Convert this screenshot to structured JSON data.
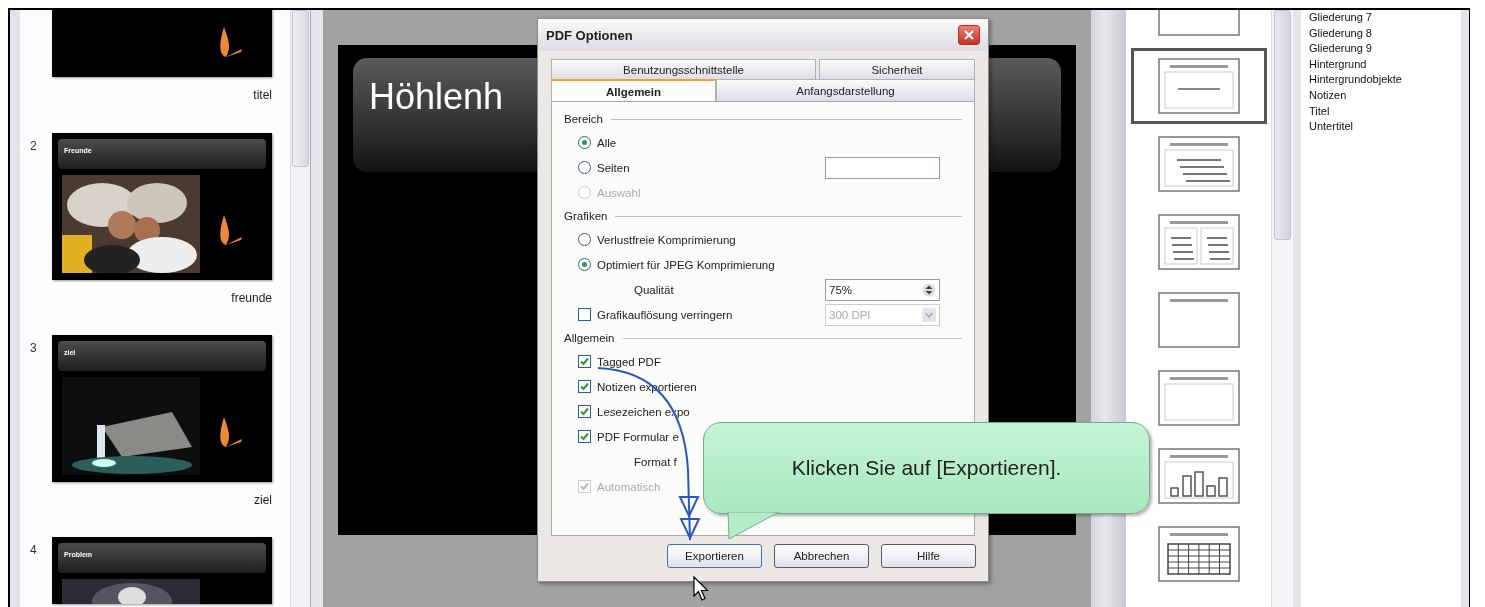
{
  "slide_panel": {
    "slides": [
      {
        "kind": "title",
        "caption": "titel"
      },
      {
        "kind": "picture",
        "number": "2",
        "heading": "Freunde",
        "caption": "freunde"
      },
      {
        "kind": "picture",
        "number": "3",
        "heading": "ziel",
        "caption": "ziel"
      },
      {
        "kind": "picture",
        "number": "4",
        "heading": "Problem"
      }
    ]
  },
  "editor": {
    "slide_title": "Höhlenh"
  },
  "dialog": {
    "title": "PDF Optionen",
    "tab_rows": [
      {
        "tabs": [
          {
            "label": "Benutzungsschnittstelle",
            "selected": false
          },
          {
            "label": "Sicherheit",
            "selected": false
          }
        ]
      },
      {
        "tabs": [
          {
            "label": "Allgemein",
            "selected": true
          },
          {
            "label": "Anfangsdarstellung",
            "selected": false
          }
        ]
      }
    ],
    "sections": [
      {
        "heading": "Bereich",
        "items": [
          {
            "kind": "radio",
            "label": "Alle",
            "selected": true,
            "disabled": false
          },
          {
            "kind": "radio",
            "label": "Seiten",
            "selected": false,
            "disabled": false,
            "field": {
              "kind": "text",
              "disabled": false
            }
          },
          {
            "kind": "radio",
            "label": "Auswahl",
            "selected": false,
            "disabled": true
          }
        ]
      },
      {
        "heading": "Grafiken",
        "items": [
          {
            "kind": "radio",
            "label": "Verlustfreie Komprimierung",
            "selected": false,
            "disabled": false
          },
          {
            "kind": "radio",
            "label": "Optimiert für JPEG Komprimierung",
            "selected": true,
            "disabled": false
          },
          {
            "kind": "label",
            "label": "Qualität",
            "field": {
              "kind": "spin",
              "value": "75%",
              "disabled": false
            }
          },
          {
            "kind": "checkbox",
            "label": "Grafikauflösung verringern",
            "checked": false,
            "disabled": false,
            "field": {
              "kind": "dropdown",
              "value": "300 DPI",
              "disabled": true
            }
          }
        ]
      },
      {
        "heading": "Allgemein",
        "items": [
          {
            "kind": "checkbox",
            "label": "Tagged PDF",
            "checked": true,
            "disabled": false
          },
          {
            "kind": "checkbox",
            "label": "Notizen exportieren",
            "checked": true,
            "disabled": false
          },
          {
            "kind": "checkbox",
            "label": "Lesezeichen expo",
            "checked": true,
            "disabled": false
          },
          {
            "kind": "checkbox",
            "label": "PDF Formular e",
            "checked": true,
            "disabled": false
          },
          {
            "kind": "label",
            "label": "Format f"
          },
          {
            "kind": "checkbox",
            "label": "Automatisch",
            "checked": true,
            "disabled": true
          }
        ]
      }
    ],
    "buttons": [
      "Exportieren",
      "Abbrechen",
      "Hilfe"
    ]
  },
  "callout": {
    "text": "Klicken Sie auf [Exportieren]."
  },
  "layouts": {
    "items": [
      {
        "kind": "blank",
        "selected": false
      },
      {
        "kind": "title",
        "selected": true
      },
      {
        "kind": "bullets",
        "selected": false
      },
      {
        "kind": "two-column",
        "selected": false
      },
      {
        "kind": "title-only",
        "selected": false
      },
      {
        "kind": "content",
        "selected": false
      },
      {
        "kind": "chart",
        "selected": false
      },
      {
        "kind": "table",
        "selected": false
      }
    ]
  },
  "styles": {
    "items": [
      "Gliederung 7",
      "Gliederung 8",
      "Gliederung 9",
      "Hintergrund",
      "Hintergrundobjekte",
      "Notizen",
      "Titel",
      "Untertitel"
    ]
  }
}
